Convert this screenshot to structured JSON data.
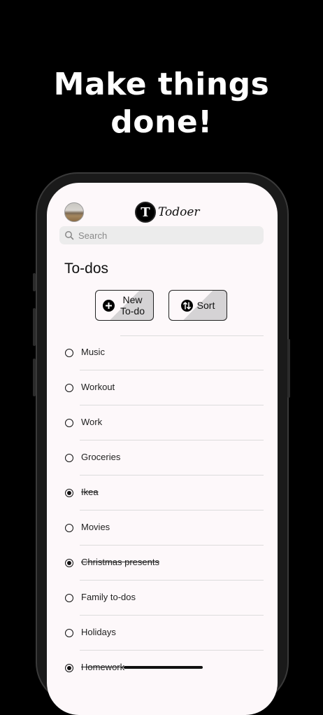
{
  "promo": {
    "headline_line1": "Make things",
    "headline_line2": "done!"
  },
  "app": {
    "logo_letter": "T",
    "logo_text": "Todoer"
  },
  "search": {
    "placeholder": "Search"
  },
  "page": {
    "title": "To-dos"
  },
  "actions": {
    "new_label": "New To-do",
    "sort_label": "Sort"
  },
  "todos": [
    {
      "label": "Music",
      "done": false
    },
    {
      "label": "Workout",
      "done": false
    },
    {
      "label": "Work",
      "done": false
    },
    {
      "label": "Groceries",
      "done": false
    },
    {
      "label": "Ikea",
      "done": true
    },
    {
      "label": "Movies",
      "done": false
    },
    {
      "label": "Christmas presents",
      "done": true
    },
    {
      "label": "Family to-dos",
      "done": false
    },
    {
      "label": "Holidays",
      "done": false
    },
    {
      "label": "Homework",
      "done": true
    }
  ],
  "colors": {
    "background": "#000000",
    "screen": "#fdf8fa",
    "text": "#111111"
  }
}
